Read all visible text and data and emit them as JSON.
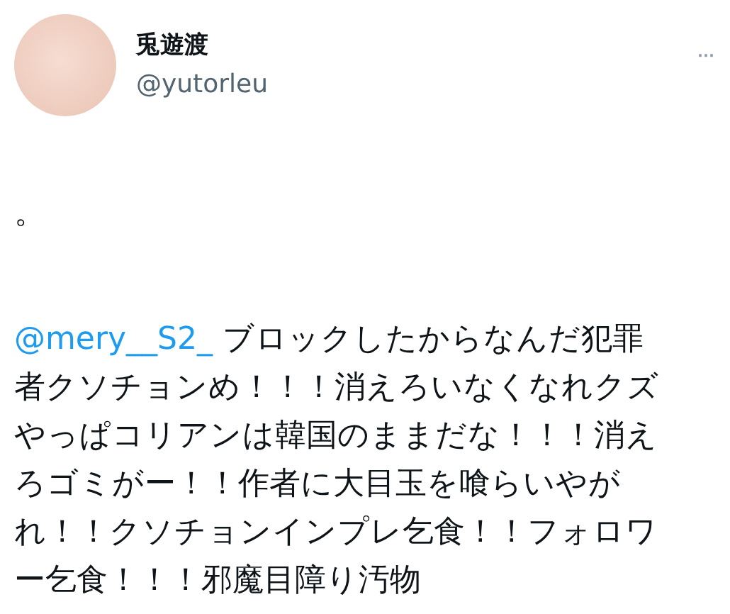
{
  "author": {
    "name": "兎遊渡",
    "handle": "@yutorleu"
  },
  "menu": {
    "glyph": "···"
  },
  "tweet": {
    "intro": "。",
    "mention": "@mery__S2_",
    "lines": [
      " ブロックしたからなんだ犯罪",
      "者クソチョンめ！！！消えろいなくなれクズ",
      "やっぱコリアンは韓国のままだな！！！消え",
      "ろゴミがー！！作者に大目玉を喰らいやが",
      "れ！！クソチョンインプレ乞食！！フォロワ",
      "ー乞食！！！邪魔目障り汚物"
    ]
  }
}
